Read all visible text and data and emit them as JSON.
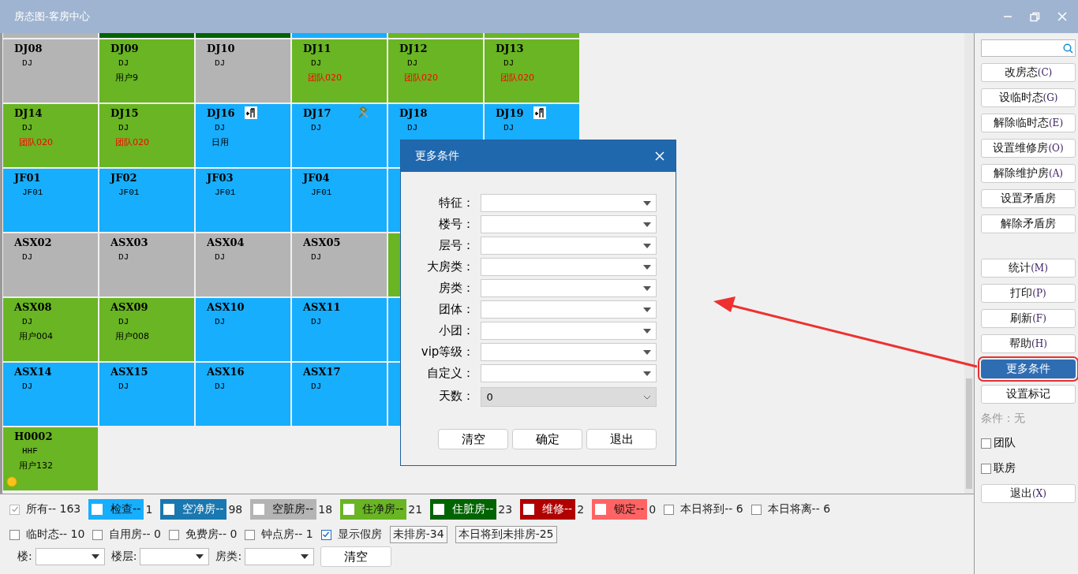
{
  "window": {
    "title": "房态图-客房中心"
  },
  "top_strip": [
    {
      "color": "#b4b4b4"
    },
    {
      "color": "#006400"
    },
    {
      "color": "#006400"
    },
    {
      "color": "#17aefd"
    },
    {
      "color": "#69b523"
    },
    {
      "color": "#69b523"
    }
  ],
  "rooms": [
    [
      {
        "room": "DJ08",
        "type": "DJ",
        "color": "#b4b4b4"
      },
      {
        "room": "DJ09",
        "type": "DJ",
        "guest": "用户9",
        "group": false,
        "color": "#69b523"
      },
      {
        "room": "DJ10",
        "type": "DJ",
        "color": "#b4b4b4"
      },
      {
        "room": "DJ11",
        "type": "DJ",
        "guest": "团队020",
        "group": true,
        "color": "#69b523"
      },
      {
        "room": "DJ12",
        "type": "DJ",
        "guest": "团队020",
        "group": true,
        "color": "#69b523"
      },
      {
        "room": "DJ13",
        "type": "DJ",
        "guest": "团队020",
        "group": true,
        "color": "#69b523"
      }
    ],
    [
      {
        "room": "DJ14",
        "type": "DJ",
        "guest": "团队020",
        "group": true,
        "color": "#69b523"
      },
      {
        "room": "DJ15",
        "type": "DJ",
        "guest": "团队020",
        "group": true,
        "color": "#69b523"
      },
      {
        "room": "DJ16",
        "type": "DJ",
        "guest": "日用",
        "group": false,
        "kind": "checkout",
        "color": "#17aefd"
      },
      {
        "room": "DJ17",
        "type": "DJ",
        "kind": "repair",
        "color": "#17aefd"
      },
      {
        "room": "DJ18",
        "type": "DJ",
        "color": "#17aefd"
      },
      {
        "room": "DJ19",
        "type": "DJ",
        "kind": "checkout",
        "color": "#17aefd"
      }
    ],
    [
      {
        "room": "JF01",
        "type": "JF01",
        "color": "#17aefd"
      },
      {
        "room": "JF02",
        "type": "JF01",
        "color": "#17aefd"
      },
      {
        "room": "JF03",
        "type": "JF01",
        "color": "#17aefd"
      },
      {
        "room": "JF04",
        "type": "JF01",
        "color": "#17aefd"
      },
      {
        "color": "#17aefd"
      }
    ],
    [
      {
        "room": "ASX02",
        "type": "DJ",
        "color": "#b4b4b4"
      },
      {
        "room": "ASX03",
        "type": "DJ",
        "color": "#b4b4b4"
      },
      {
        "room": "ASX04",
        "type": "DJ",
        "color": "#b4b4b4"
      },
      {
        "room": "ASX05",
        "type": "DJ",
        "color": "#b4b4b4"
      },
      {
        "color": "#69b523"
      }
    ],
    [
      {
        "room": "ASX08",
        "type": "DJ",
        "guest": "用户004",
        "group": false,
        "color": "#69b523"
      },
      {
        "room": "ASX09",
        "type": "DJ",
        "guest": "用户008",
        "group": false,
        "color": "#69b523"
      },
      {
        "room": "ASX10",
        "type": "DJ",
        "color": "#17aefd"
      },
      {
        "room": "ASX11",
        "type": "DJ",
        "color": "#17aefd"
      },
      {
        "color": "#17aefd"
      }
    ],
    [
      {
        "room": "ASX14",
        "type": "DJ",
        "color": "#17aefd"
      },
      {
        "room": "ASX15",
        "type": "DJ",
        "color": "#17aefd"
      },
      {
        "room": "ASX16",
        "type": "DJ",
        "color": "#17aefd"
      },
      {
        "room": "ASX17",
        "type": "DJ",
        "color": "#17aefd"
      },
      {
        "color": "#17aefd"
      }
    ],
    [
      {
        "room": "H0002",
        "type": "HHF",
        "guest": "用户132",
        "group": false,
        "kind": "hourly",
        "color": "#69b523"
      }
    ]
  ],
  "dialog": {
    "title": "更多条件",
    "fields": [
      {
        "label": "特征：",
        "kind": "combo"
      },
      {
        "label": "楼号：",
        "kind": "combo"
      },
      {
        "label": "层号：",
        "kind": "combo"
      },
      {
        "label": "大房类：",
        "kind": "combo"
      },
      {
        "label": "房类：",
        "kind": "combo"
      },
      {
        "label": "团体：",
        "kind": "combo"
      },
      {
        "label": "小团：",
        "kind": "combo"
      },
      {
        "label": "vip等级：",
        "kind": "combo"
      },
      {
        "label": "自定义：",
        "kind": "combo"
      },
      {
        "label": "天数：",
        "kind": "select",
        "value": "0"
      }
    ],
    "buttons": [
      "清空",
      "确定",
      "退出"
    ]
  },
  "sidebar": [
    {
      "kind": "search"
    },
    {
      "kind": "button",
      "label": "改房态",
      "shortcut": "(C)",
      "active": false,
      "annotated": false
    },
    {
      "kind": "button",
      "label": "设临时态",
      "shortcut": "(G)",
      "active": false,
      "annotated": false
    },
    {
      "kind": "button",
      "label": "解除临时态",
      "shortcut": "(E)",
      "active": false,
      "annotated": false
    },
    {
      "kind": "button",
      "label": "设置维修房",
      "shortcut": "(O)",
      "active": false,
      "annotated": false
    },
    {
      "kind": "button",
      "label": "解除维护房",
      "shortcut": "(A)",
      "active": false,
      "annotated": false
    },
    {
      "kind": "button",
      "label": "设置矛盾房",
      "active": false,
      "annotated": false
    },
    {
      "kind": "button",
      "label": "解除矛盾房",
      "active": false,
      "annotated": false
    },
    {
      "kind": "gap"
    },
    {
      "kind": "button",
      "label": "统计",
      "shortcut": "(M)",
      "active": false,
      "annotated": false
    },
    {
      "kind": "button",
      "label": "打印",
      "shortcut": "(P)",
      "active": false,
      "annotated": false
    },
    {
      "kind": "button",
      "label": "刷新",
      "shortcut": "(F)",
      "active": false,
      "annotated": false
    },
    {
      "kind": "button",
      "label": "帮助",
      "shortcut": "(H)",
      "active": false,
      "annotated": false
    },
    {
      "kind": "button",
      "label": "更多条件",
      "active": true,
      "annotated": true
    },
    {
      "kind": "button",
      "label": "设置标记",
      "active": false,
      "annotated": false
    },
    {
      "kind": "text",
      "label": "条件：无"
    },
    {
      "kind": "checkbox",
      "label": "团队",
      "checked": false
    },
    {
      "kind": "checkbox",
      "label": "联房",
      "checked": false
    },
    {
      "kind": "button",
      "label": "退出",
      "shortcut": "(X)",
      "active": false,
      "annotated": false
    }
  ],
  "legend_rows": [
    [
      {
        "kind": "plain",
        "label": "所有-- 163",
        "checked": true,
        "disabled": true
      },
      {
        "kind": "status",
        "label": "检查--",
        "count": "1",
        "color": "#17aefd",
        "checked": false
      },
      {
        "kind": "status",
        "label": "空净房--",
        "count": "98",
        "color": "#1a78b0",
        "checked": false
      },
      {
        "kind": "status",
        "label": "空脏房--",
        "count": "18",
        "color": "#b4b4b4",
        "checked": false
      },
      {
        "kind": "status",
        "label": "住净房--",
        "count": "21",
        "color": "#69b523",
        "checked": false
      },
      {
        "kind": "status",
        "label": "住脏房--",
        "count": "23",
        "color": "#006400",
        "checked": false
      },
      {
        "kind": "status",
        "label": "维修--",
        "count": "2",
        "color": "#b00000",
        "checked": false
      },
      {
        "kind": "status",
        "label": "锁定--",
        "count": "0",
        "color": "#ff6464",
        "checked": false
      },
      {
        "kind": "plain",
        "label": "本日将到-- 6",
        "checked": false,
        "disabled": false
      },
      {
        "kind": "plain",
        "label": "本日将离-- 6",
        "checked": false,
        "disabled": false
      }
    ],
    [
      {
        "kind": "plain",
        "label": "临时态-- 10",
        "checked": false,
        "disabled": false
      },
      {
        "kind": "plain",
        "label": "自用房-- 0",
        "checked": false,
        "disabled": false
      },
      {
        "kind": "plain",
        "label": "免费房-- 0",
        "checked": false,
        "disabled": false
      },
      {
        "kind": "plain",
        "label": "钟点房-- 1",
        "checked": false,
        "disabled": false
      },
      {
        "kind": "plain",
        "label": "显示假房",
        "checked": true,
        "disabled": false
      },
      {
        "kind": "tag",
        "label": "未排房-34"
      },
      {
        "kind": "tag",
        "label": "本日将到未排房-25"
      }
    ]
  ],
  "filters": [
    {
      "label": "楼:"
    },
    {
      "label": "楼层:"
    },
    {
      "label": "房类:"
    }
  ],
  "clear_button": "清空"
}
